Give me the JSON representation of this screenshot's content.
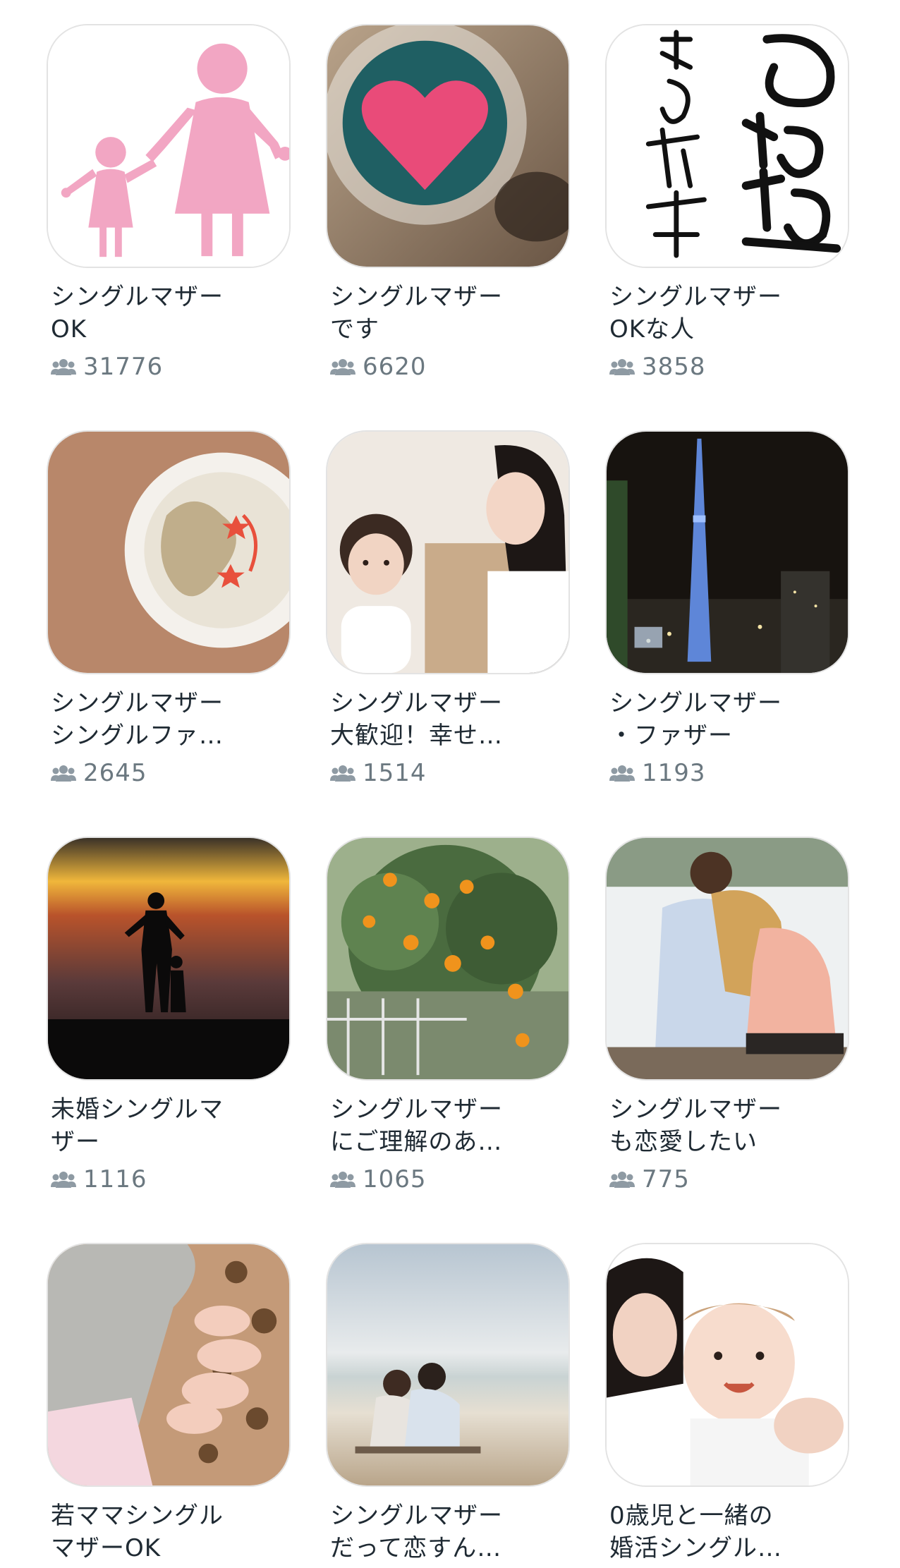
{
  "colors": {
    "title_text": "#1f2a33",
    "count_text": "#6b7880",
    "icon": "#8e9aa3"
  },
  "communities": [
    {
      "title": "シングルマザー\nOK",
      "members": "31776",
      "thumb_icon": "mother-and-child-silhouette"
    },
    {
      "title": "シングルマザー\nです",
      "members": "6620",
      "thumb_icon": "heart-cup-photo"
    },
    {
      "title": "シングルマザー\nOKな人",
      "members": "3858",
      "thumb_icon": "calligraphy-image"
    },
    {
      "title": "シングルマザー\nシングルファ…",
      "members": "2645",
      "thumb_icon": "latte-art-photo"
    },
    {
      "title": "シングルマザー\n大歓迎！幸せ…",
      "members": "1514",
      "thumb_icon": "mother-daughter-photo"
    },
    {
      "title": "シングルマザー\n・ファザー",
      "members": "1193",
      "thumb_icon": "sky-tower-night-photo"
    },
    {
      "title": "未婚シングルマ\nザー",
      "members": "1116",
      "thumb_icon": "sunset-silhouette-photo"
    },
    {
      "title": "シングルマザー\nにご理解のあ…",
      "members": "1065",
      "thumb_icon": "orange-tree-photo"
    },
    {
      "title": "シングルマザー\nも恋愛したい",
      "members": "775",
      "thumb_icon": "couple-lake-photo"
    },
    {
      "title": "若ママシングル\nマザーOK",
      "members": "",
      "thumb_icon": "baby-hand-photo"
    },
    {
      "title": "シングルマザー\nだって恋すん…",
      "members": "",
      "thumb_icon": "beach-couple-photo"
    },
    {
      "title": "0歳児と一緒の\n婚活シングル…",
      "members": "",
      "thumb_icon": "mother-baby-photo"
    }
  ]
}
